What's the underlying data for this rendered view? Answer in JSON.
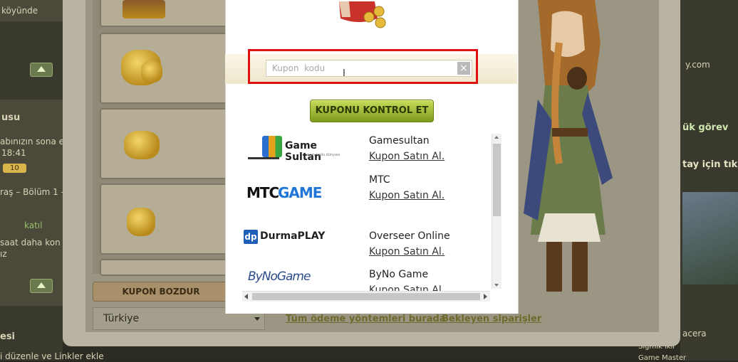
{
  "background": {
    "left_texts": [
      "köyünde",
      "usu",
      "abınızın sona er",
      "18:41",
      "10",
      "raş – Bölüm 1 –",
      "katıl",
      "saat daha kon",
      "ız",
      "esi",
      "i düzenle ve Linkler ekle"
    ],
    "right_texts": [
      "y.com",
      "ük görev",
      "tay için tıkla",
      "acera",
      "Sigmik ikir",
      "Game Master"
    ]
  },
  "shop": {
    "coupon_tab_label": "KUPON BOZDUR",
    "country_value": "Türkiye",
    "payment_methods_link": "Tüm ödeme yöntemleri burada",
    "pending_orders_link": "Bekleyen siparişler"
  },
  "modal": {
    "coupon_placeholder": "Kupon  kodu",
    "check_button_label": "KUPONU KONTROL ET",
    "providers": [
      {
        "logo_text": "Game Sultan",
        "logo_sub": "oyun kodu dünyası",
        "name": "Gamesultan",
        "link": "Kupon Satın Al."
      },
      {
        "logo_text_a": "MTC",
        "logo_text_b": "GAME",
        "name": "MTC",
        "link": "Kupon Satın Al."
      },
      {
        "logo_badge": "dp",
        "logo_text": "DurmaPLAY",
        "name": "Overseer Online",
        "link": "Kupon Satın Al."
      },
      {
        "logo_text": "ByNoGame",
        "name": "ByNo Game",
        "link": "Kupon Satın Al."
      }
    ]
  },
  "colors": {
    "highlight": "#e01010",
    "button": "#9cb82c"
  }
}
